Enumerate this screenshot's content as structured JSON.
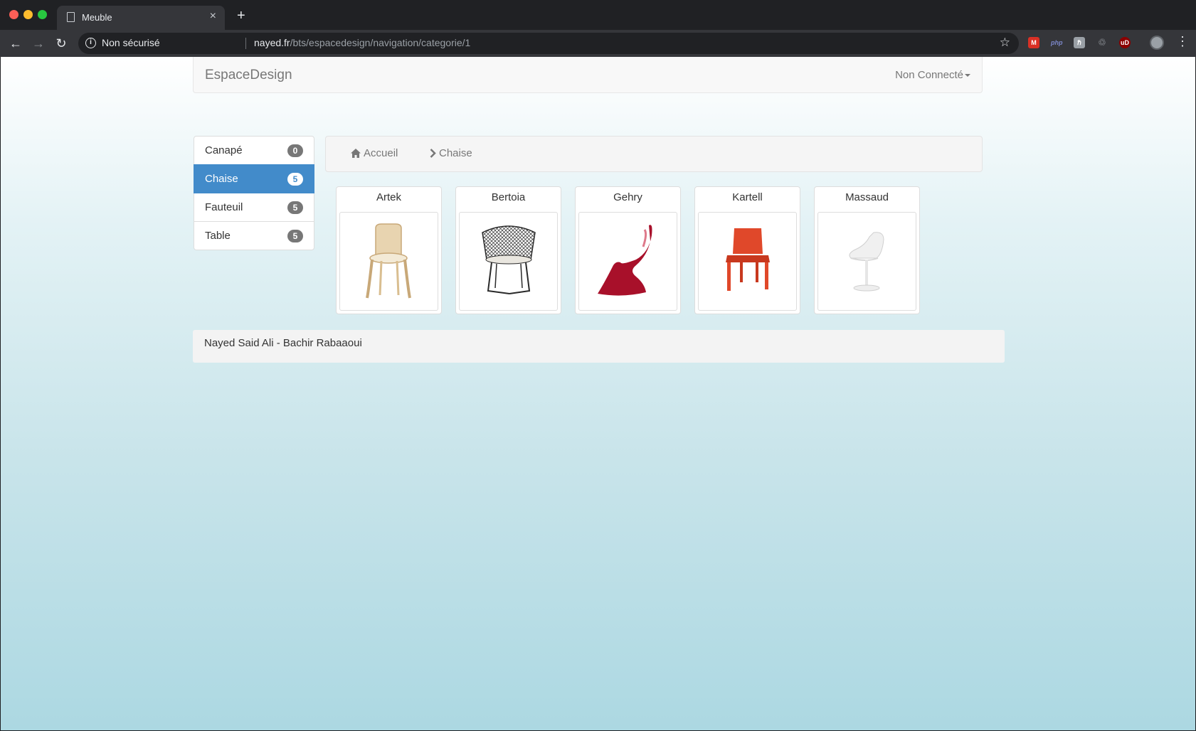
{
  "browser": {
    "tab_title": "Meuble",
    "security_label": "Non sécurisé",
    "url_host": "nayed.fr",
    "url_path": "/bts/espacedesign/navigation/categorie/1",
    "new_tab_symbol": "+",
    "close_symbol": "×",
    "ext_php": "php",
    "ext_h": "ℏ",
    "ext_ub": "uD"
  },
  "navbar": {
    "brand": "EspaceDesign",
    "user_menu": "Non Connecté"
  },
  "categories": [
    {
      "label": "Canapé",
      "count": "0",
      "active": false
    },
    {
      "label": "Chaise",
      "count": "5",
      "active": true
    },
    {
      "label": "Fauteuil",
      "count": "5",
      "active": false
    },
    {
      "label": "Table",
      "count": "5",
      "active": false
    }
  ],
  "breadcrumb": {
    "home": "Accueil",
    "current": "Chaise"
  },
  "products": [
    {
      "name": "Artek",
      "color": "#e8d4b0"
    },
    {
      "name": "Bertoia",
      "color": "#2a2a2a"
    },
    {
      "name": "Gehry",
      "color": "#a8102a"
    },
    {
      "name": "Kartell",
      "color": "#e0482a"
    },
    {
      "name": "Massaud",
      "color": "#f0f0f0"
    }
  ],
  "footer": {
    "text": "Nayed Said Ali - Bachir Rabaaoui"
  },
  "colors": {
    "accent": "#428bca",
    "badge": "#777777"
  }
}
